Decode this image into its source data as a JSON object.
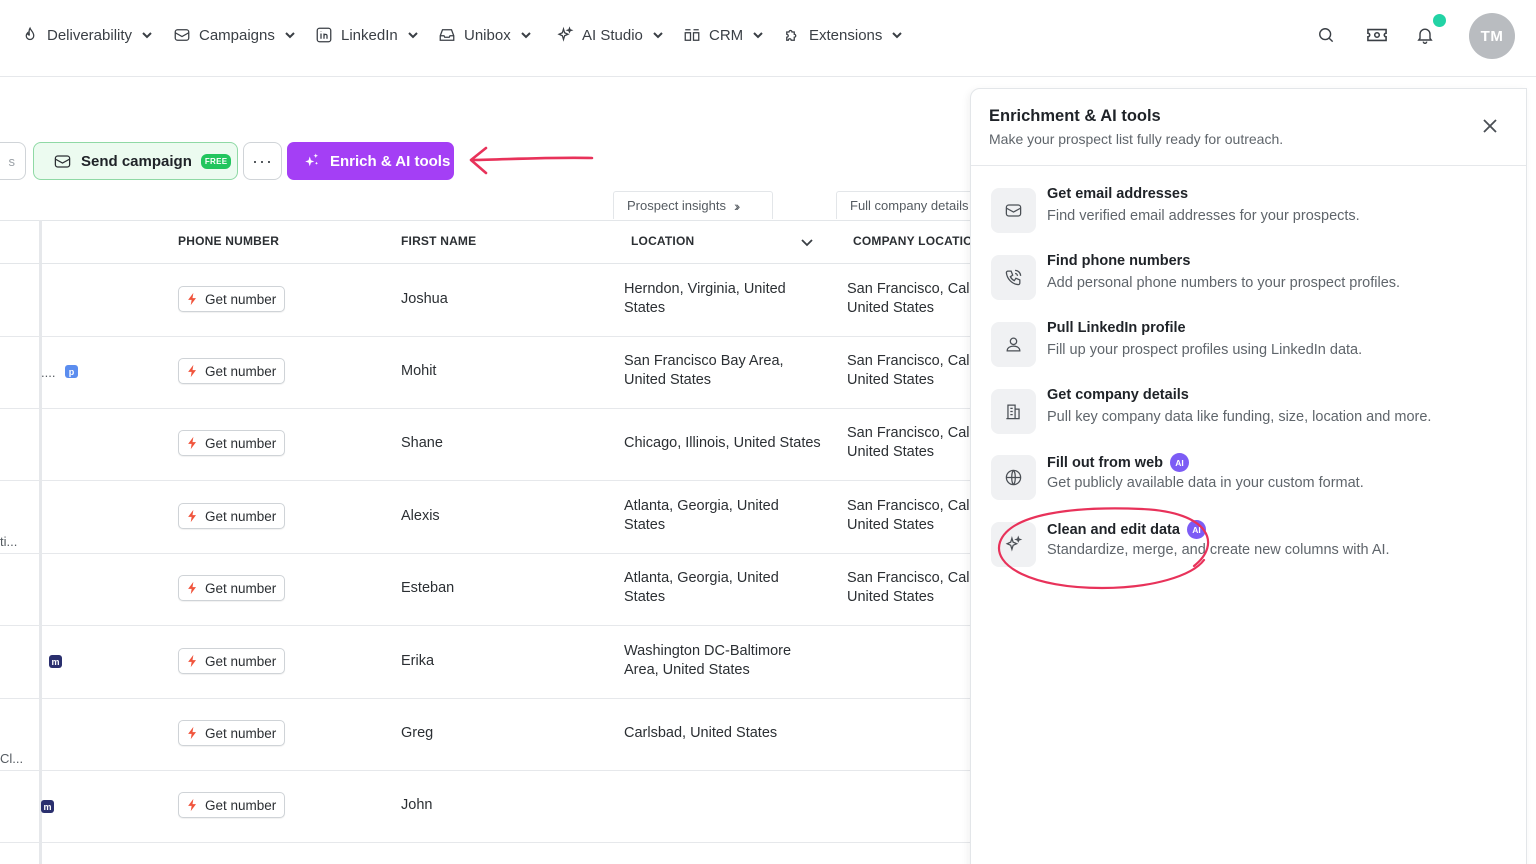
{
  "nav": {
    "items": [
      {
        "label": "Deliverability",
        "icon": "flame-icon"
      },
      {
        "label": "Campaigns",
        "icon": "mail-icon"
      },
      {
        "label": "LinkedIn",
        "icon": "linkedin-icon"
      },
      {
        "label": "Unibox",
        "icon": "inbox-icon"
      },
      {
        "label": "AI Studio",
        "icon": "sparkles-icon"
      },
      {
        "label": "CRM",
        "icon": "crm-icon"
      },
      {
        "label": "Extensions",
        "icon": "puzzle-icon"
      }
    ],
    "avatar_initials": "TM",
    "notification_dot_color": "#22d3a5"
  },
  "toolbar": {
    "cut_label": "s",
    "send_label": "Send campaign",
    "send_badge": "FREE",
    "more_label": "···",
    "enrich_label": "Enrich & AI tools",
    "enrich_color": "#a43ff5"
  },
  "groups": {
    "prospect_insights": "Prospect insights",
    "company_details": "Full company details"
  },
  "table": {
    "headers": {
      "phone": "PHONE NUMBER",
      "first_name": "FIRST NAME",
      "location": "LOCATION",
      "company_location": "COMPANY LOCATION"
    },
    "get_number_label": "Get number",
    "rows": [
      {
        "first_name": "Joshua",
        "location": [
          "Herndon, Virginia, United",
          "States"
        ],
        "company_location": [
          "San Francisco, California,",
          "United States"
        ]
      },
      {
        "first_name": "Mohit",
        "location": [
          "San Francisco Bay Area,",
          "United States"
        ],
        "company_location": [
          "San Francisco, California,",
          "United States"
        ]
      },
      {
        "first_name": "Shane",
        "location": [
          "Chicago, Illinois, United States"
        ],
        "company_location": [
          "San Francisco, California,",
          "United States"
        ]
      },
      {
        "first_name": "Alexis",
        "location": [
          "Atlanta, Georgia, United",
          "States"
        ],
        "company_location": [
          "San Francisco, California,",
          "United States"
        ]
      },
      {
        "first_name": "Esteban",
        "location": [
          "Atlanta, Georgia, United",
          "States"
        ],
        "company_location": [
          "San Francisco, California,",
          "United States"
        ]
      },
      {
        "first_name": "Erika",
        "location": [
          "Washington DC-Baltimore",
          "Area, United States"
        ],
        "company_location": []
      },
      {
        "first_name": "Greg",
        "location": [
          "Carlsbad, United States"
        ],
        "company_location": []
      },
      {
        "first_name": "John",
        "location": [],
        "company_location": []
      }
    ],
    "fragments": {
      "row2": "....",
      "row2_badge": "p",
      "row4": "ti...",
      "row6_badge": "m",
      "row7": "Cl...",
      "row8_badge": "m"
    }
  },
  "panel": {
    "title": "Enrichment & AI tools",
    "subtitle": "Make your prospect list fully ready for outreach.",
    "tools": [
      {
        "title": "Get email addresses",
        "desc": "Find verified email addresses for your prospects.",
        "icon": "mail-icon"
      },
      {
        "title": "Find phone numbers",
        "desc": "Add personal phone numbers to your prospect profiles.",
        "icon": "phone-icon"
      },
      {
        "title": "Pull LinkedIn profile",
        "desc": "Fill up your prospect profiles using LinkedIn data.",
        "icon": "user-icon"
      },
      {
        "title": "Get company details",
        "desc": "Pull key company data like funding, size, location and more.",
        "icon": "building-icon"
      },
      {
        "title": "Fill out from web",
        "desc": "Get publicly available data in your custom format.",
        "icon": "globe-icon",
        "badge": "AI"
      },
      {
        "title": "Clean and edit data",
        "desc": "Standardize, merge, and create new columns with AI.",
        "icon": "sparkles-icon",
        "badge": "AI"
      }
    ]
  },
  "annotation_color": "#e8325a"
}
